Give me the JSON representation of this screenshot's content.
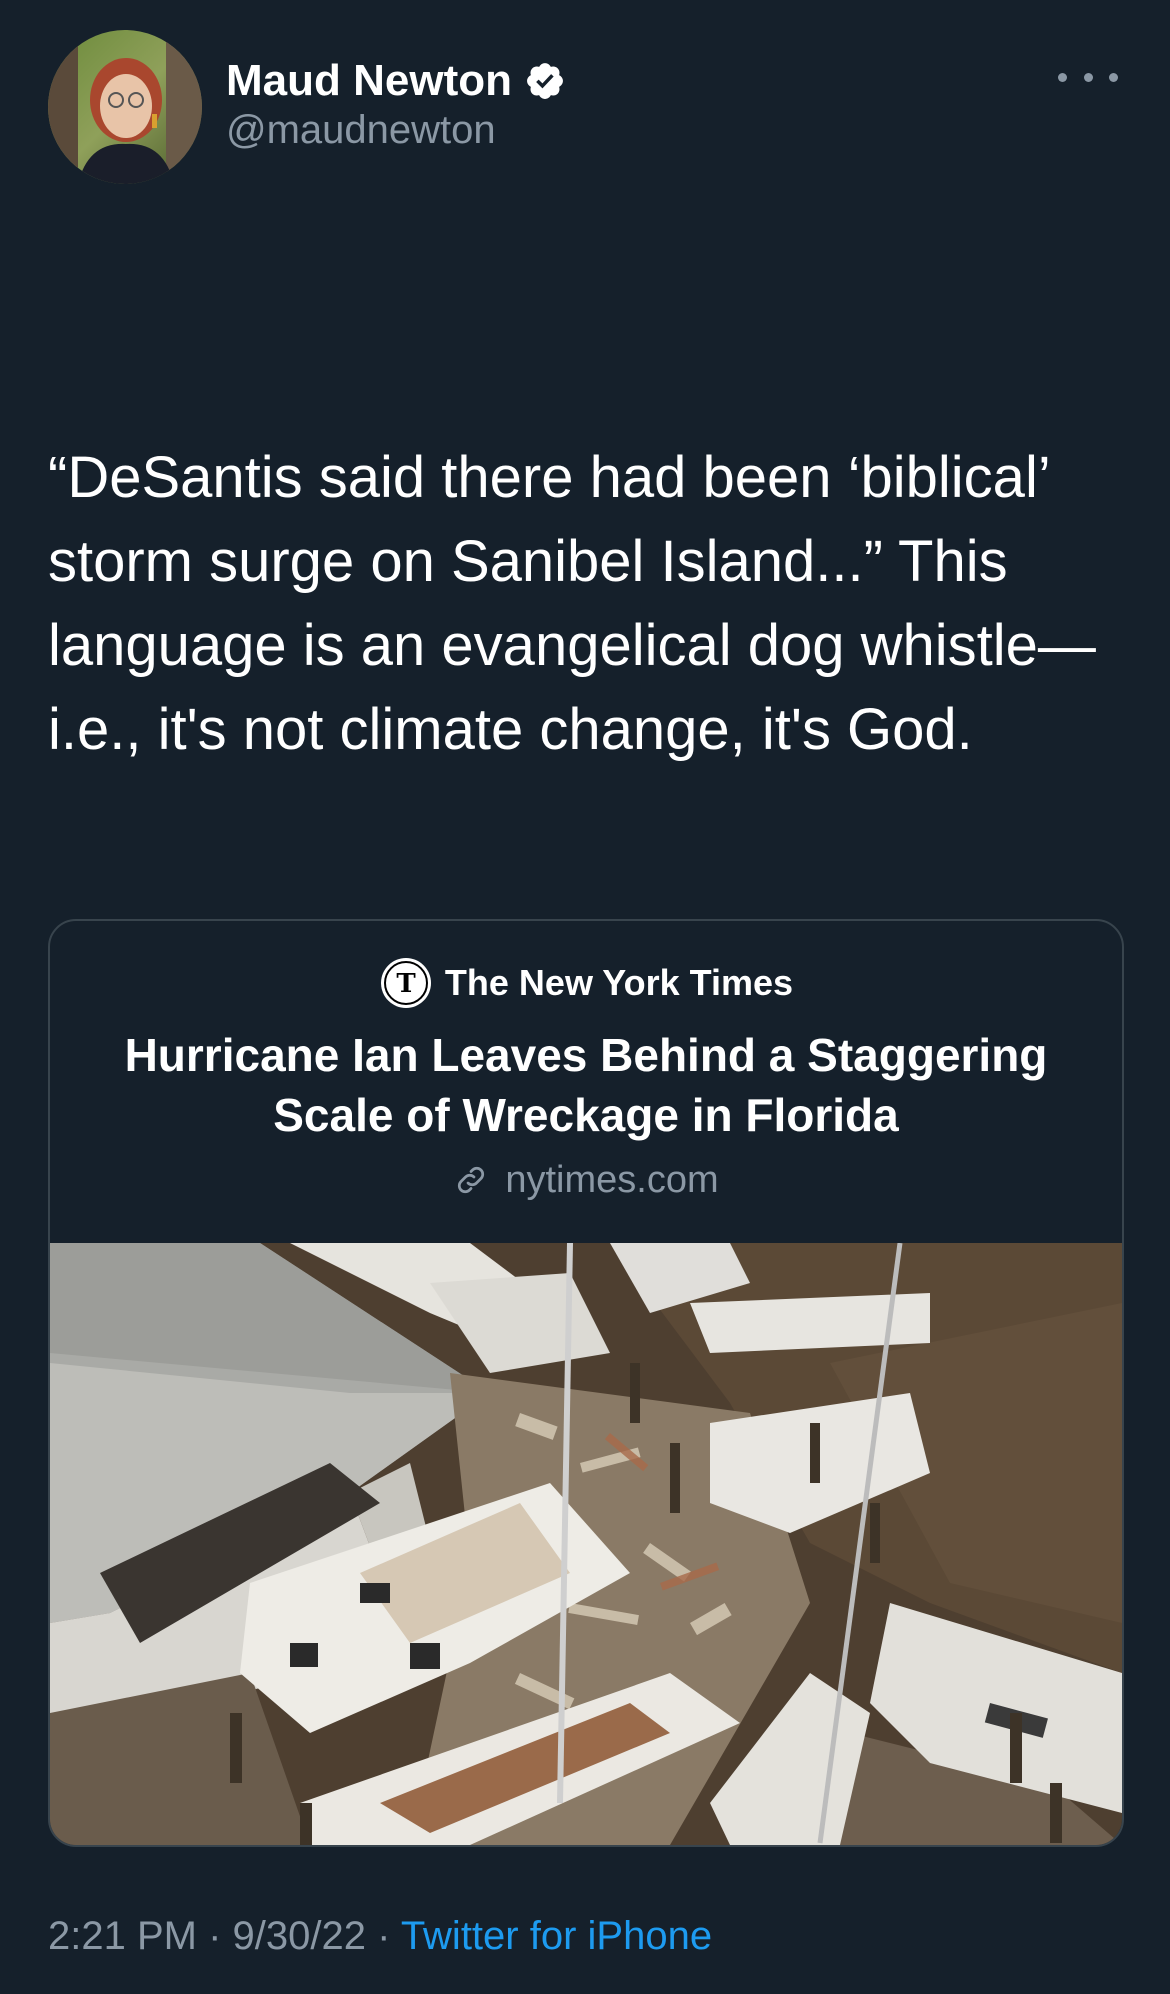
{
  "author": {
    "display_name": "Maud Newton",
    "handle": "@maudnewton",
    "verified_icon": "verified-badge-icon",
    "avatar_icon": "profile-avatar"
  },
  "tweet": {
    "text": "“DeSantis said there had been ‘biblical’ storm surge on Sanibel Island...” This language is an evangelical dog whistle—i.e., it's not climate change, it's God."
  },
  "link_card": {
    "source_icon": "nyt-logo-icon",
    "source_name": "The New York Times",
    "title": "Hurricane Ian Leaves Behind a Staggering Scale of Wreckage in Florida",
    "domain_icon": "link-icon",
    "domain": "nytimes.com",
    "image": "hurricane-wreckage-photo"
  },
  "meta": {
    "time": "2:21 PM",
    "separator": " · ",
    "date": "9/30/22",
    "source_app": "Twitter for iPhone"
  },
  "colors": {
    "background": "#15202b",
    "text_primary": "#ffffff",
    "text_secondary": "#8b98a5",
    "accent": "#1d9bf0",
    "border": "#38444d"
  }
}
